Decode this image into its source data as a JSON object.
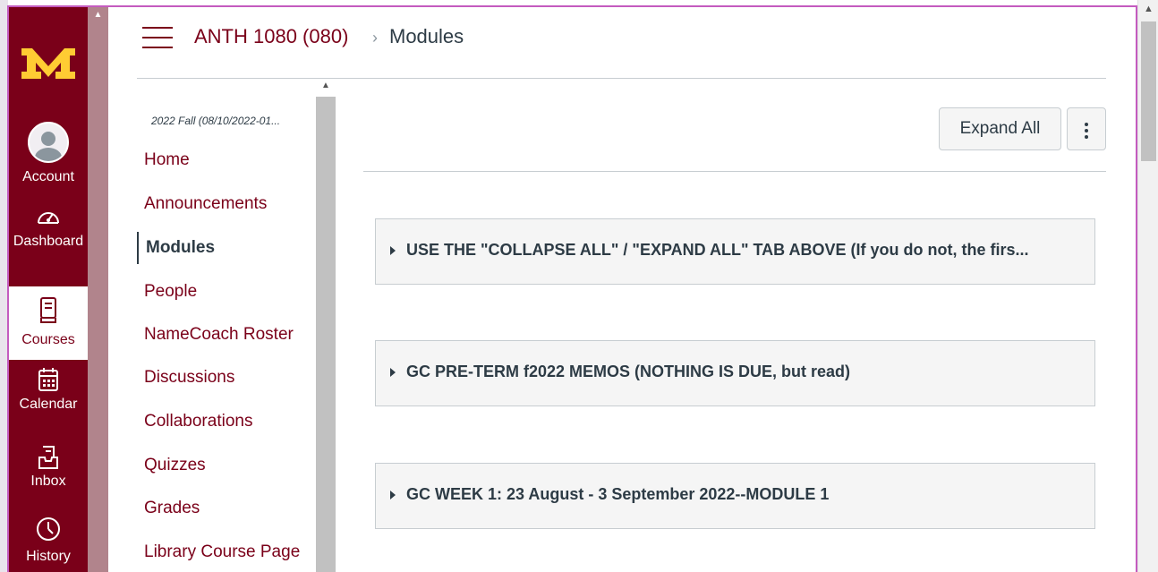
{
  "global_nav": {
    "brand_color": "#7a0019",
    "items": [
      {
        "label": "Account",
        "icon": "avatar-icon"
      },
      {
        "label": "Dashboard",
        "icon": "speedometer-icon"
      },
      {
        "label": "Courses",
        "icon": "book-icon",
        "active": true
      },
      {
        "label": "Calendar",
        "icon": "calendar-icon"
      },
      {
        "label": "Inbox",
        "icon": "inbox-icon"
      },
      {
        "label": "History",
        "icon": "clock-icon"
      }
    ]
  },
  "breadcrumb": {
    "course": "ANTH 1080 (080)",
    "separator": "›",
    "current": "Modules"
  },
  "course_nav": {
    "term": "2022 Fall (08/10/2022-01...",
    "links": [
      {
        "label": "Home"
      },
      {
        "label": "Announcements"
      },
      {
        "label": "Modules",
        "active": true
      },
      {
        "label": "People"
      },
      {
        "label": "NameCoach Roster"
      },
      {
        "label": "Discussions"
      },
      {
        "label": "Collaborations"
      },
      {
        "label": "Quizzes"
      },
      {
        "label": "Grades"
      },
      {
        "label": "Library Course Page"
      }
    ]
  },
  "toolbar": {
    "expand_all_label": "Expand All"
  },
  "modules": [
    {
      "title": "USE THE \"COLLAPSE ALL\" / \"EXPAND ALL\" TAB ABOVE (If you do not, the firs..."
    },
    {
      "title": "GC PRE-TERM f2022 MEMOS (NOTHING IS DUE, but read)"
    },
    {
      "title": "GC WEEK 1: 23 August - 3 September 2022--MODULE 1"
    }
  ]
}
